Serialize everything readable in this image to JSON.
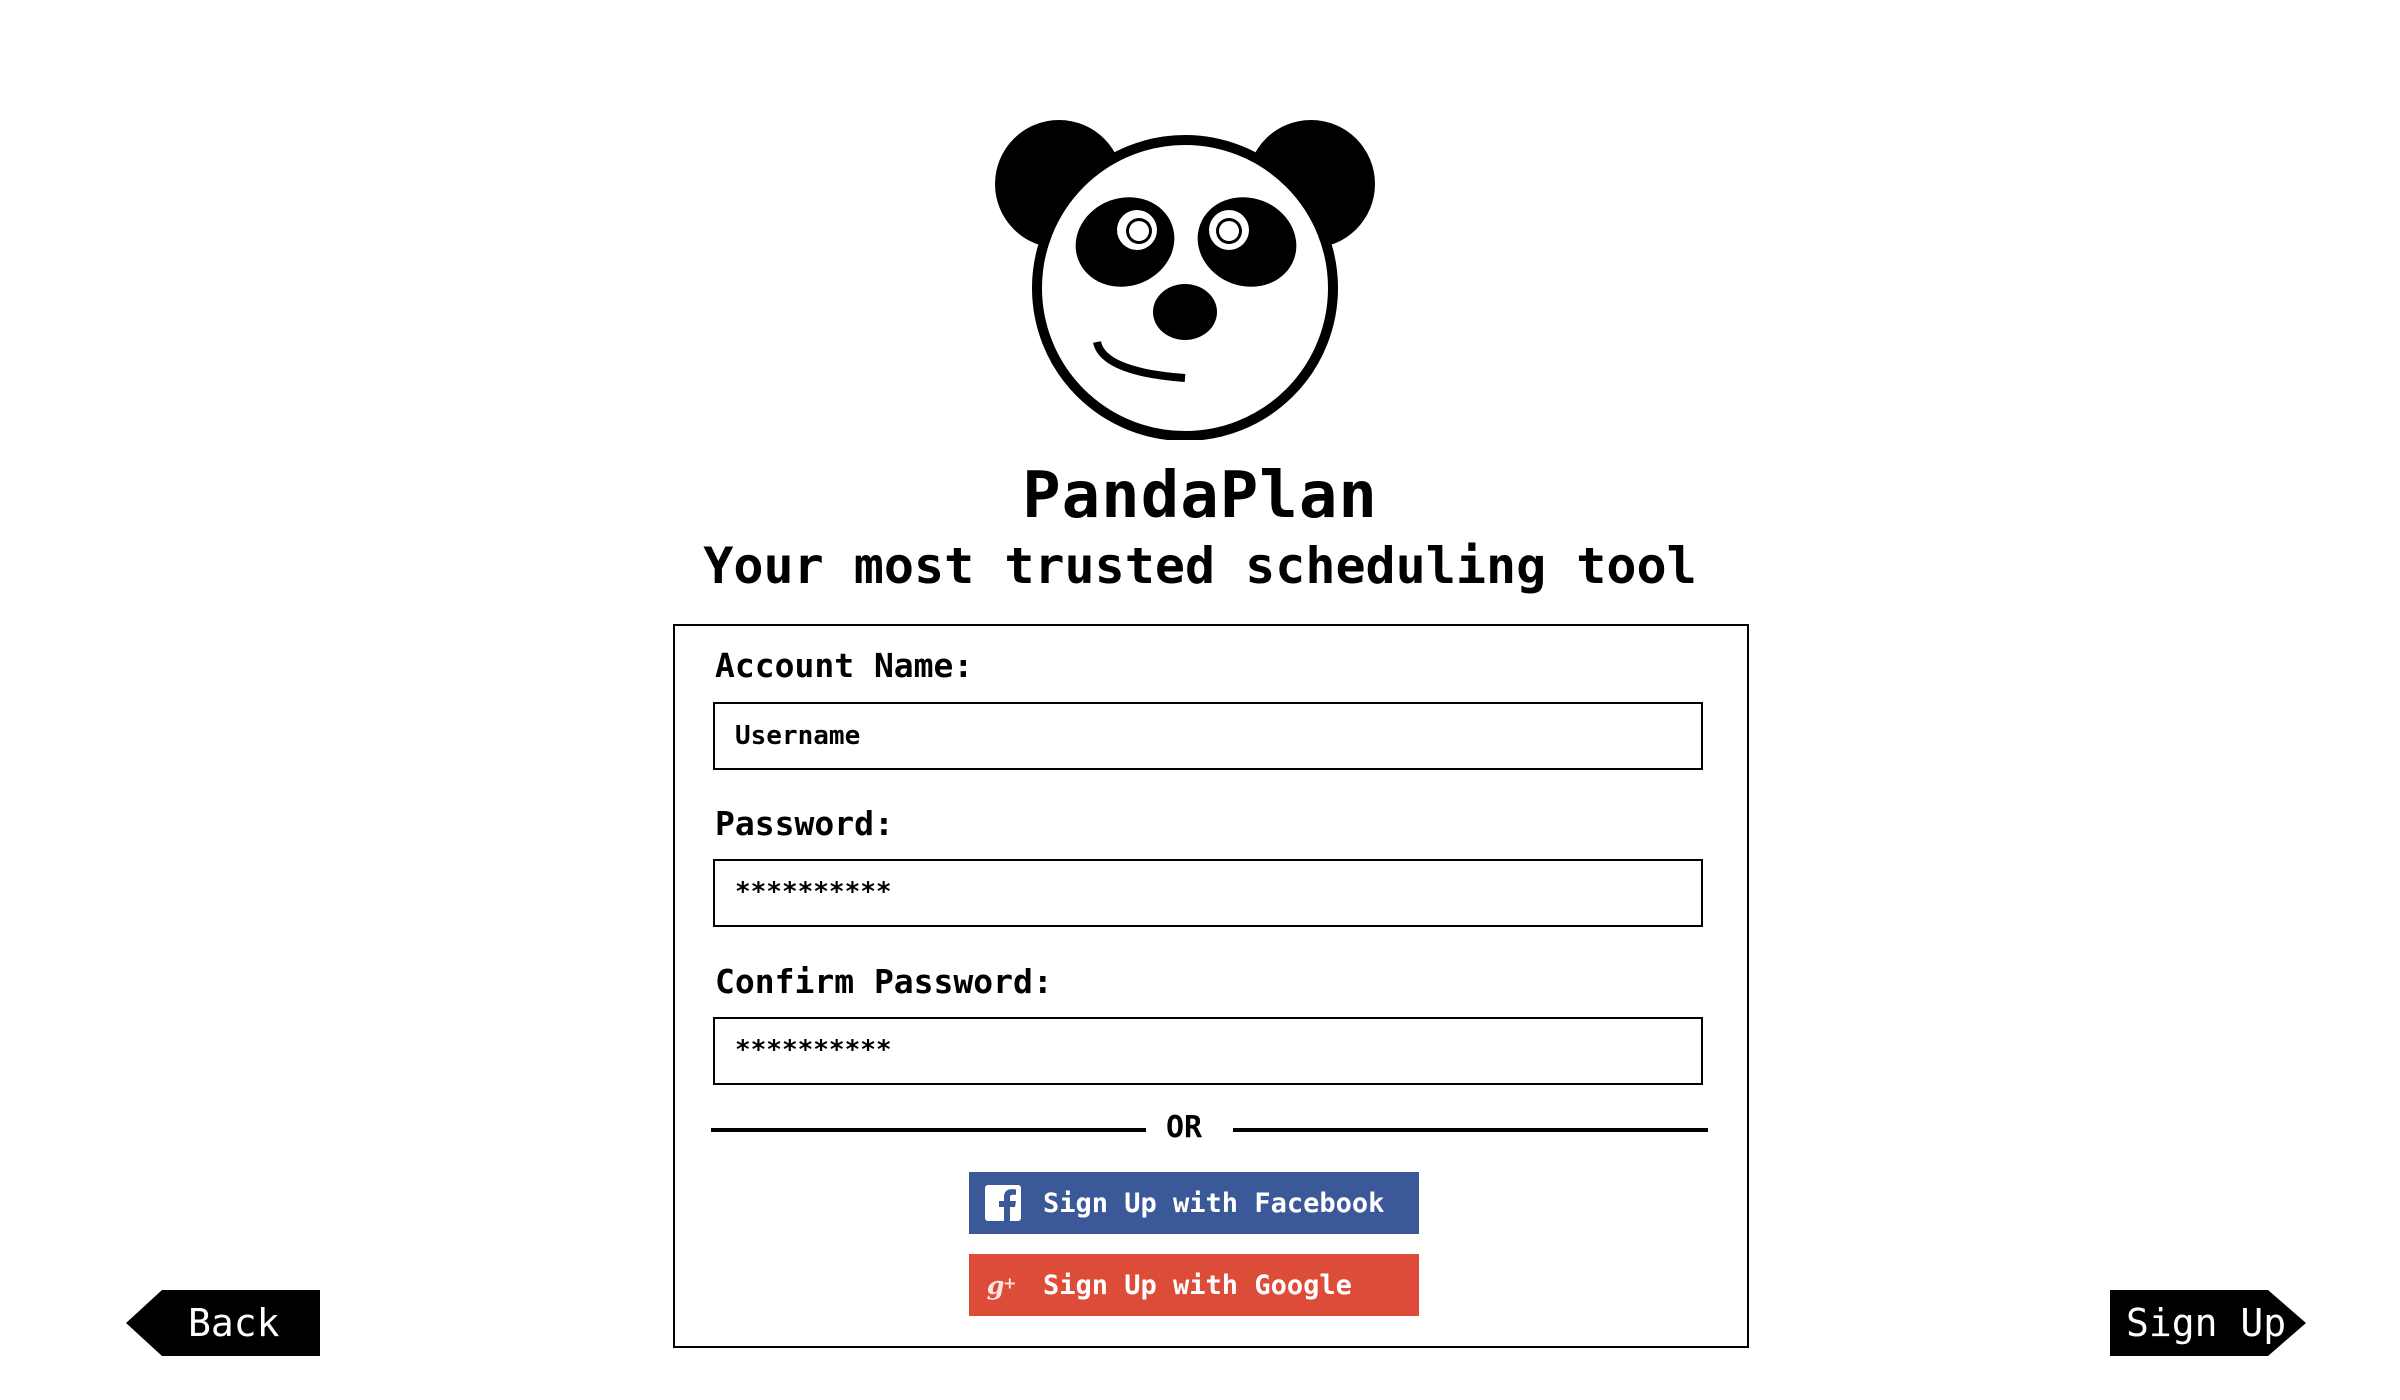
{
  "app": {
    "title": "PandaPlan",
    "tagline": "Your most trusted scheduling tool"
  },
  "form": {
    "account_name_label": "Account Name:",
    "username_placeholder": "Username",
    "password_label": "Password:",
    "password_value": "**********",
    "confirm_password_label": "Confirm Password:",
    "confirm_password_value": "**********",
    "divider_text": "OR"
  },
  "social": {
    "facebook_label": "Sign Up with Facebook",
    "facebook_color": "#3b5998",
    "google_label": "Sign Up with Google",
    "google_color": "#dd4b39"
  },
  "nav": {
    "back_label": "Back",
    "signup_label": "Sign Up"
  },
  "icons": {
    "logo": "panda-logo",
    "facebook": "facebook-icon",
    "google": "google-plus-icon"
  }
}
